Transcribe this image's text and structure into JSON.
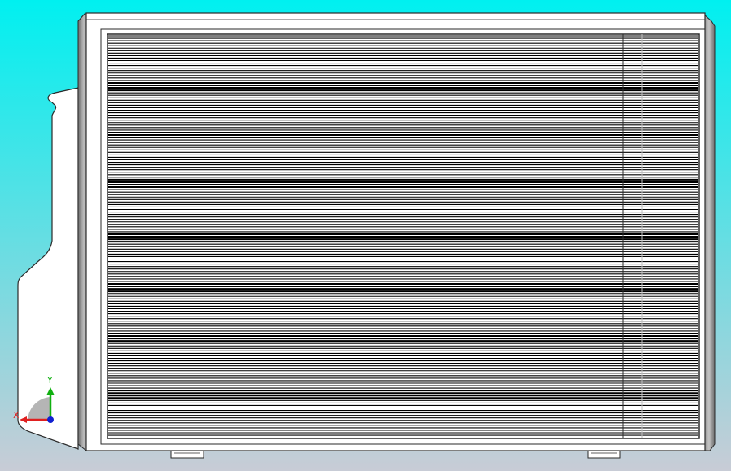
{
  "viewport": {
    "background_top": "#00F0F0",
    "background_bottom": "#C8CCD6"
  },
  "model": {
    "name": "outdoor-ac-unit",
    "view": "front",
    "colors": {
      "casing": "#FFFFFF",
      "casing_edge": "#2A2A2A",
      "side_panel": "#9A9A9A",
      "grille_dark": "#000000",
      "grille_light": "#FFFFFF"
    }
  },
  "triad": {
    "x_label": "X",
    "y_label": "Y",
    "x_color": "#E02020",
    "y_color": "#10B010",
    "z_color": "#1020D0"
  }
}
